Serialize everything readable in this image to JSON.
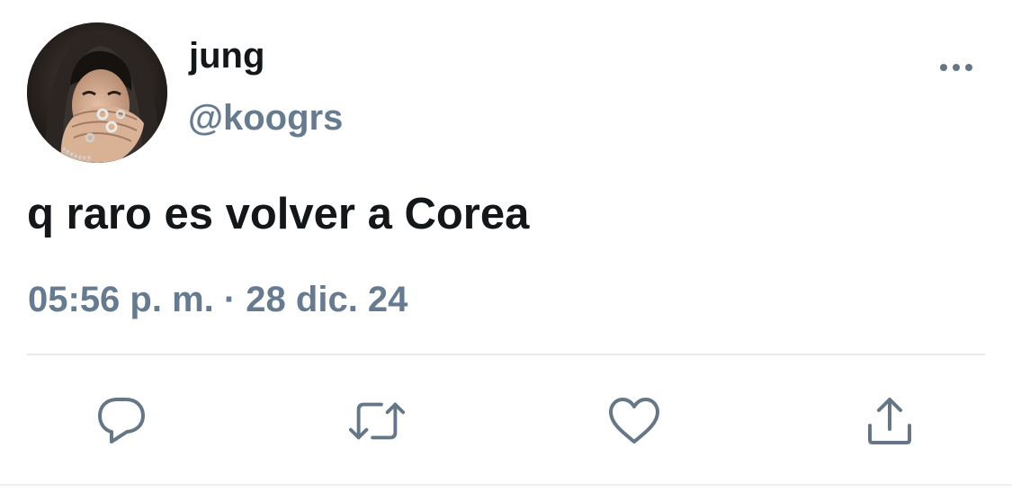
{
  "tweet": {
    "author": {
      "display_name": "jung",
      "handle": "@koogrs",
      "avatar_icon": "profile-photo"
    },
    "text": "q raro es volver a Corea",
    "timestamp": "05:56 p. m. · 28 dic. 24"
  },
  "actions": {
    "more_icon": "more-horizontal-icon",
    "reply_icon": "reply-icon",
    "retweet_icon": "retweet-icon",
    "like_icon": "heart-icon",
    "share_icon": "share-icon"
  },
  "colors": {
    "text_primary": "#14171a",
    "text_secondary": "#667b8f",
    "icon": "#657786",
    "divider": "#e6ecf0"
  }
}
